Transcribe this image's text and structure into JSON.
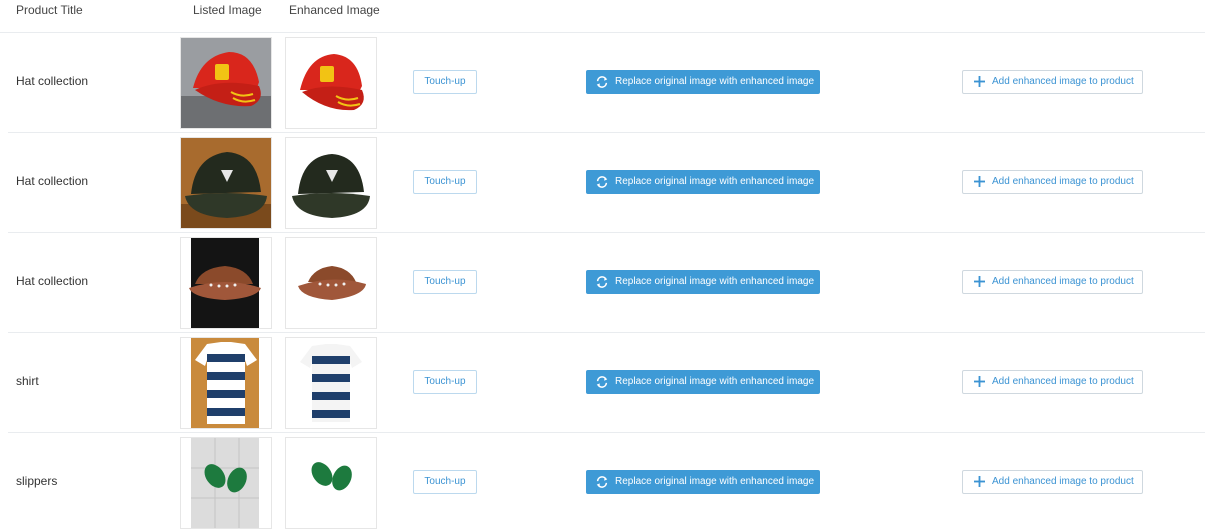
{
  "table": {
    "columns": {
      "title": "Product Title",
      "listed": "Listed Image",
      "enhanced": "Enhanced Image"
    },
    "rows": [
      {
        "title": "Hat collection",
        "listed_image": "red-ferrari-cap-photo",
        "enhanced_image": "red-ferrari-cap-cutout",
        "touch_up": "Touch-up",
        "replace": "Replace original image with enhanced image",
        "add": "Add enhanced image to product"
      },
      {
        "title": "Hat collection",
        "listed_image": "black-volcom-cap-photo",
        "enhanced_image": "black-volcom-cap-cutout",
        "touch_up": "Touch-up",
        "replace": "Replace original image with enhanced image",
        "add": "Add enhanced image to product"
      },
      {
        "title": "Hat collection",
        "listed_image": "brown-cowboy-hat-photo",
        "enhanced_image": "brown-cowboy-hat-cutout",
        "touch_up": "Touch-up",
        "replace": "Replace original image with enhanced image",
        "add": "Add enhanced image to product"
      },
      {
        "title": "shirt",
        "listed_image": "striped-polo-shirt-photo",
        "enhanced_image": "striped-polo-shirt-cutout",
        "touch_up": "Touch-up",
        "replace": "Replace original image with enhanced image",
        "add": "Add enhanced image to product"
      },
      {
        "title": "slippers",
        "listed_image": "green-flip-flops-photo",
        "enhanced_image": "green-flip-flops-cutout",
        "touch_up": "Touch-up",
        "replace": "Replace original image with enhanced image",
        "add": "Add enhanced image to product"
      }
    ]
  },
  "colors": {
    "accent": "#3e9ad6",
    "link": "#3b93d3",
    "divider": "#e9ecef"
  },
  "icons": {
    "replace": "refresh-icon",
    "add": "plus-icon"
  }
}
